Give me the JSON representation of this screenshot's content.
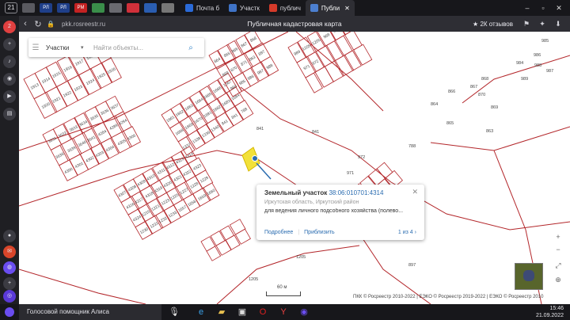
{
  "browser": {
    "tab_count": "21",
    "mini_tabs": [
      {
        "label": "",
        "color": "#5a5a60"
      },
      {
        "label": "РЛ",
        "color": "#1f3f8a"
      },
      {
        "label": "РЛ",
        "color": "#1f3f8a"
      },
      {
        "label": "РМ",
        "color": "#c42222"
      },
      {
        "label": "",
        "color": "#3a8e4a"
      },
      {
        "label": "",
        "color": "#6a6a70"
      },
      {
        "label": "",
        "color": "#d0303a"
      },
      {
        "label": "",
        "color": "#2a5db0"
      },
      {
        "label": "",
        "color": "#777"
      }
    ],
    "page_tabs": [
      {
        "label": "Почта б",
        "icon_color": "#2a6ad8",
        "active": false
      },
      {
        "label": "Участк",
        "icon_color": "#3f73c6",
        "active": false
      },
      {
        "label": "публич",
        "icon_color": "#d43a2a",
        "active": false
      },
      {
        "label": "Публи",
        "icon_color": "#4c7fd0",
        "active": true
      }
    ],
    "url": "pkk.rosreestr.ru",
    "page_title": "Публичная кадастровая карта",
    "reviews": "★ 2К отзывов"
  },
  "sidebar": {
    "badge": "2"
  },
  "search": {
    "type": "Участки",
    "placeholder": "Найти объекты..."
  },
  "map": {
    "parcel_labels": [
      "1913",
      "1914",
      "1915",
      "1916",
      "1917",
      "1918",
      "1919",
      "1920",
      "1921",
      "1922",
      "1923",
      "1924",
      "1925",
      "1926",
      "3631",
      "3632",
      "3633",
      "3634",
      "3635",
      "3636",
      "3637",
      "3638",
      "3639",
      "3640",
      "3641",
      "4284",
      "4289",
      "4294",
      "4300",
      "4301",
      "4302",
      "4303",
      "4304",
      "4305",
      "4306",
      "4307",
      "4308",
      "4309",
      "4310",
      "4311",
      "4312",
      "4313",
      "4314",
      "4316",
      "4317",
      "4318",
      "4319",
      "4320",
      "4321",
      "4322",
      "4323",
      "4324",
      "1215",
      "1221",
      "1223",
      "1225",
      "1227",
      "1228",
      "1229",
      "1230",
      "1231",
      "1232",
      "1233",
      "1657",
      "1658",
      "1659",
      "1660",
      "1661",
      "1662",
      "1663",
      "1664",
      "1665",
      "1666",
      "1667",
      "1668",
      "1669",
      "1670",
      "1681",
      "1682",
      "1683",
      "1684",
      "1337",
      "1338",
      "1339",
      "1340",
      "841",
      "841",
      "788",
      "864",
      "865",
      "866",
      "867",
      "868",
      "869",
      "870",
      "871",
      "863",
      "897",
      "984",
      "985",
      "986",
      "987",
      "988",
      "989",
      "1205",
      "1205",
      "968",
      "969",
      "970",
      "971",
      "972"
    ]
  },
  "popup": {
    "title_prefix": "Земельный участок",
    "cadastral_number": "38:06:010701:4314",
    "address": "Иркутская область, Иркутский район",
    "use": "для ведения личного подсобного хозяйства (полево...",
    "link_details": "Подробнее",
    "link_zoom": "Приблизить",
    "pager": "1 из 4"
  },
  "controls": {
    "scale": "60 м",
    "copyright": "ПКК © Росреестр 2010-2022 | ЕЭКО © Росреестр 2019-2022 | ЕЭКО © Росреестр 2010"
  },
  "taskbar": {
    "search_text": "Голосовой помощник Алиса",
    "time": "15:46",
    "date": "21.09.2022"
  },
  "colors": {
    "parcel_line": "#b3262a",
    "highlight": "#f2e13a",
    "link": "#2a6cb0"
  }
}
